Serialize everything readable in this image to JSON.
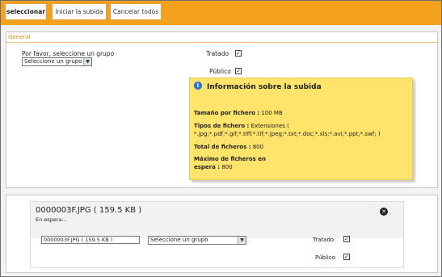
{
  "toolbar": {
    "select_label": "seleccionar",
    "start_label": "Iniciar la subida",
    "cancel_label": "Cancelar todos"
  },
  "general": {
    "title": "General",
    "group_prompt": "Por favor, seleccione un grupo",
    "group_select_value": "Seleccione un grupo",
    "tratado_label": "Tratado",
    "tratado_checked": "✓",
    "publico_label": "Público",
    "publico_checked": "✓"
  },
  "info": {
    "title": "Información sobre la subida",
    "size_label": "Tamaño por fichero :",
    "size_value": " 100 MB",
    "types_label": "Tipos de fichero :",
    "types_value": " Extensiones ( *.jpg;*.pdf;*.gif;*.tiff;*.tif;*.jpeg;*.txt;*.doc;*.xls;*.avi;*.ppt;*.swf; )",
    "total_label": "Total de ficheros :",
    "total_value": " 800",
    "max_label": "Máximo de ficheros en espera :",
    "max_value": " 800"
  },
  "upload": {
    "file_title": "0000003F.JPG  ( 159.5 KB )",
    "status": "En espera...",
    "name_value": "0000003F.JPG  ( 159.5 KB )",
    "group_select_value": "Seleccione un grupo",
    "tratado_label": "Tratado",
    "tratado_checked": "✓",
    "publico_label": "Público",
    "publico_checked": "✓"
  },
  "icons": {
    "info": "info-icon",
    "close": "close-icon",
    "dropdown": "chevron-down-icon"
  },
  "colors": {
    "toolbar": "#f4a21e",
    "info_box": "#ffe36b",
    "panel_title": "#e08a10"
  }
}
